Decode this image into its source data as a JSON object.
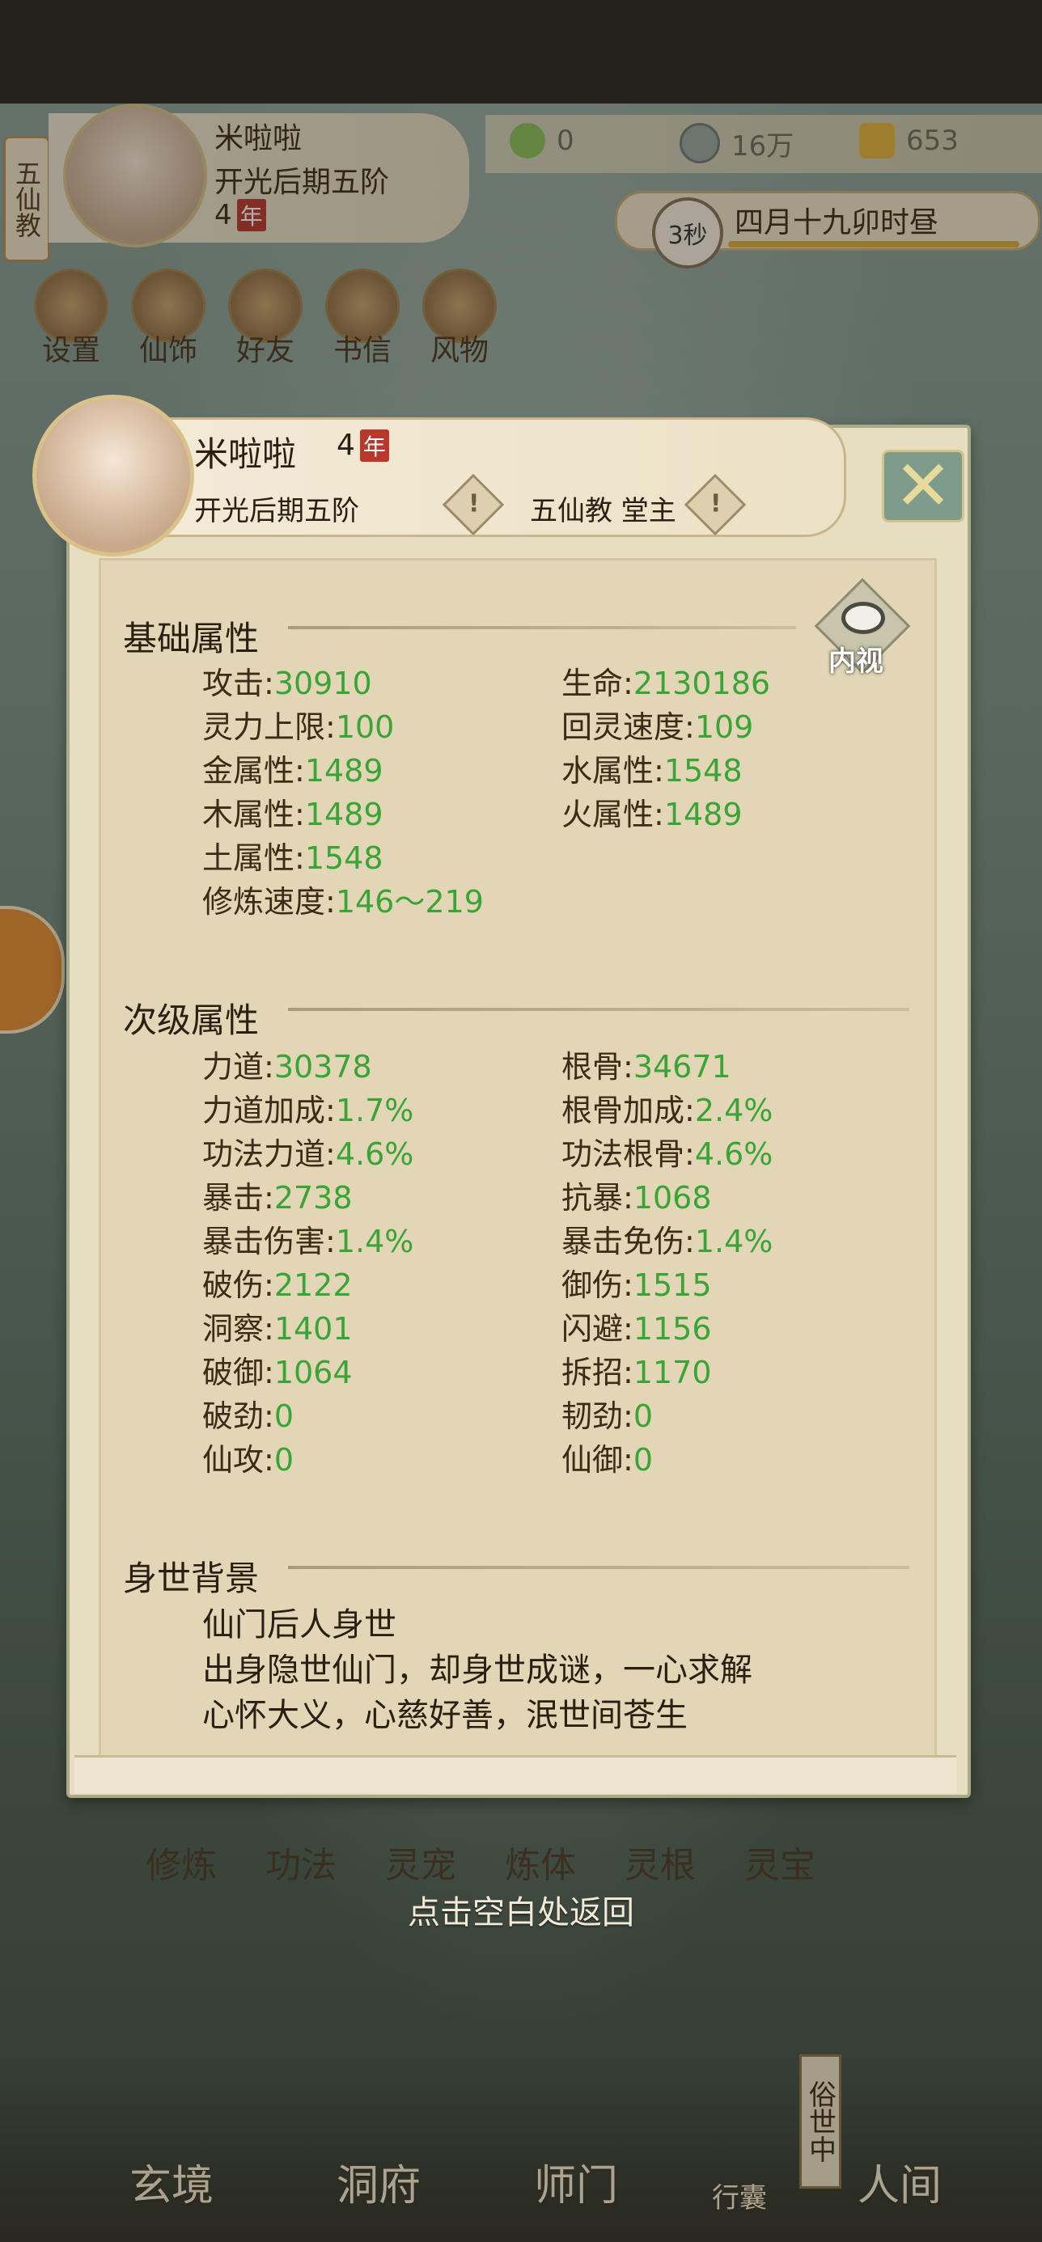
{
  "hud": {
    "sect_tag": "五仙教",
    "name": "米啦啦",
    "realm": "开光后期五阶",
    "age_num": "4",
    "age_unit": "年",
    "resources": [
      {
        "icon": "leaf-icon",
        "value": "0"
      },
      {
        "icon": "coin-icon",
        "value": "16万"
      },
      {
        "icon": "ingot-icon",
        "value": "653"
      }
    ],
    "timer": "3秒",
    "date": "四月十九卯时昼"
  },
  "menu": [
    "设置",
    "仙饰",
    "好友",
    "书信",
    "风物"
  ],
  "panel": {
    "name": "米啦啦",
    "age_num": "4",
    "age_unit": "年",
    "realm": "开光后期五阶",
    "sect": "五仙教 堂主",
    "warn_glyph": "!",
    "close_glyph": "✕"
  },
  "basic": {
    "title": "基础属性",
    "inspect_label": "内视",
    "left": [
      {
        "label": "攻击:",
        "value": "30910"
      },
      {
        "label": "灵力上限:",
        "value": "100"
      },
      {
        "label": "金属性:",
        "value": "1489"
      },
      {
        "label": "木属性:",
        "value": "1489"
      },
      {
        "label": "土属性:",
        "value": "1548"
      },
      {
        "label": "修炼速度:",
        "value": "146～219"
      }
    ],
    "right": [
      {
        "label": "生命:",
        "value": "2130186"
      },
      {
        "label": "回灵速度:",
        "value": "109"
      },
      {
        "label": "水属性:",
        "value": "1548"
      },
      {
        "label": "火属性:",
        "value": "1489"
      }
    ]
  },
  "secondary": {
    "title": "次级属性",
    "left": [
      {
        "label": "力道:",
        "value": "30378"
      },
      {
        "label": "力道加成:",
        "value": "1.7%"
      },
      {
        "label": "功法力道:",
        "value": "4.6%"
      },
      {
        "label": "暴击:",
        "value": "2738"
      },
      {
        "label": "暴击伤害:",
        "value": "1.4%"
      },
      {
        "label": "破伤:",
        "value": "2122"
      },
      {
        "label": "洞察:",
        "value": "1401"
      },
      {
        "label": "破御:",
        "value": "1064"
      },
      {
        "label": "破劲:",
        "value": "0"
      },
      {
        "label": "仙攻:",
        "value": "0"
      }
    ],
    "right": [
      {
        "label": "根骨:",
        "value": "34671"
      },
      {
        "label": "根骨加成:",
        "value": "2.4%"
      },
      {
        "label": "功法根骨:",
        "value": "4.6%"
      },
      {
        "label": "抗暴:",
        "value": "1068"
      },
      {
        "label": "暴击免伤:",
        "value": "1.4%"
      },
      {
        "label": "御伤:",
        "value": "1515"
      },
      {
        "label": "闪避:",
        "value": "1156"
      },
      {
        "label": "拆招:",
        "value": "1170"
      },
      {
        "label": "韧劲:",
        "value": "0"
      },
      {
        "label": "仙御:",
        "value": "0"
      }
    ]
  },
  "background": {
    "title": "身世背景",
    "lines": [
      "仙门后人身世",
      "出身隐世仙门，却身世成谜，一心求解",
      "心怀大义，心慈好善，泯世间苍生"
    ]
  },
  "return_hint": "点击空白处返回",
  "bottom_tabs": [
    "修炼",
    "功法",
    "灵宠",
    "炼体",
    "灵根",
    "灵宝"
  ],
  "nav": [
    "玄境",
    "洞府",
    "师门",
    "行囊",
    "人间"
  ],
  "nav_side_tag": "俗世中"
}
